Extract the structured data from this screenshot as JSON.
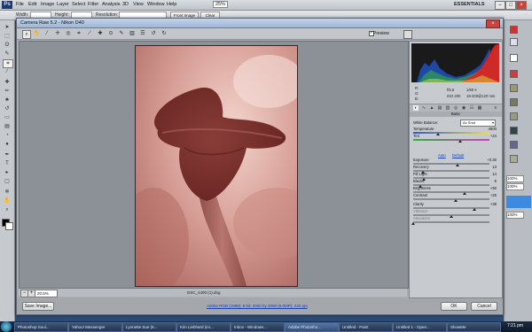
{
  "photoshop": {
    "menus": [
      "File",
      "Edit",
      "Image",
      "Layer",
      "Select",
      "Filter",
      "Analysis",
      "3D",
      "View",
      "Window",
      "Help"
    ],
    "zoom": "25%",
    "workspace": "ESSENTIALS",
    "options_bar": {
      "width_label": "Width:",
      "height_label": "Height:",
      "resolution_label": "Resolution:",
      "front_image": "Front Image",
      "clear": "Clear"
    },
    "panels": {
      "pct1": "100%",
      "pct2": "100%",
      "pct3": "100%"
    }
  },
  "dialog": {
    "title": "Camera Raw 5.2  -  Nikon D40",
    "preview_label": "Preview",
    "preview_checked": true,
    "zoom_value": "20.5%",
    "filename": "DSC_4400 (1).dng",
    "save_button": "Save Image...",
    "workflow_link": "Adobe RGB (1998); 8 bit; 2000 by 3008 (6.0MP); 240 ppi",
    "ok_button": "OK",
    "cancel_button": "Cancel",
    "camera_info": {
      "aperture": "f/5.6",
      "shutter": "1/60 s",
      "iso": "ISO 400",
      "lens": "18-200@120 mm",
      "r": "R:",
      "g": "G:",
      "b": "B:"
    },
    "basic": {
      "header": "Basic",
      "white_balance_label": "White Balance:",
      "white_balance_value": "As Shot",
      "auto": "Auto",
      "default": "Default",
      "sliders": [
        {
          "label": "Temperature",
          "value": "4600",
          "level": 0.33
        },
        {
          "label": "Tint",
          "value": "+24",
          "level": 0.62
        },
        {
          "label": "Exposure",
          "value": "+0.30",
          "level": 0.58
        },
        {
          "label": "Recovery",
          "value": "13",
          "level": 0.13
        },
        {
          "label": "Fill Light",
          "value": "14",
          "level": 0.14
        },
        {
          "label": "Blacks",
          "value": "9",
          "level": 0.09
        },
        {
          "label": "Brightness",
          "value": "+50",
          "level": 0.68
        },
        {
          "label": "Contrast",
          "value": "+25",
          "level": 0.56
        },
        {
          "label": "Clarity",
          "value": "+38",
          "level": 0.8
        },
        {
          "label": "Vibrance",
          "value": "",
          "level": 0.5
        },
        {
          "label": "Saturation",
          "value": "",
          "level": 0.0
        }
      ]
    }
  },
  "taskbar": {
    "items": [
      "Photoshop Soul...",
      "Yahoo! Messenger",
      "Lynnette Sue (6...",
      "Kim Liebhard (im...",
      "Inbox - Windows...",
      "Adobe Photosho...",
      "Untitled - Paint",
      "Untitled 1 - Open...",
      "ShowMe"
    ],
    "clock": "7:21 pm"
  },
  "colors": {
    "photo_tint": "#c98b84",
    "accent": "#3d8be0"
  }
}
